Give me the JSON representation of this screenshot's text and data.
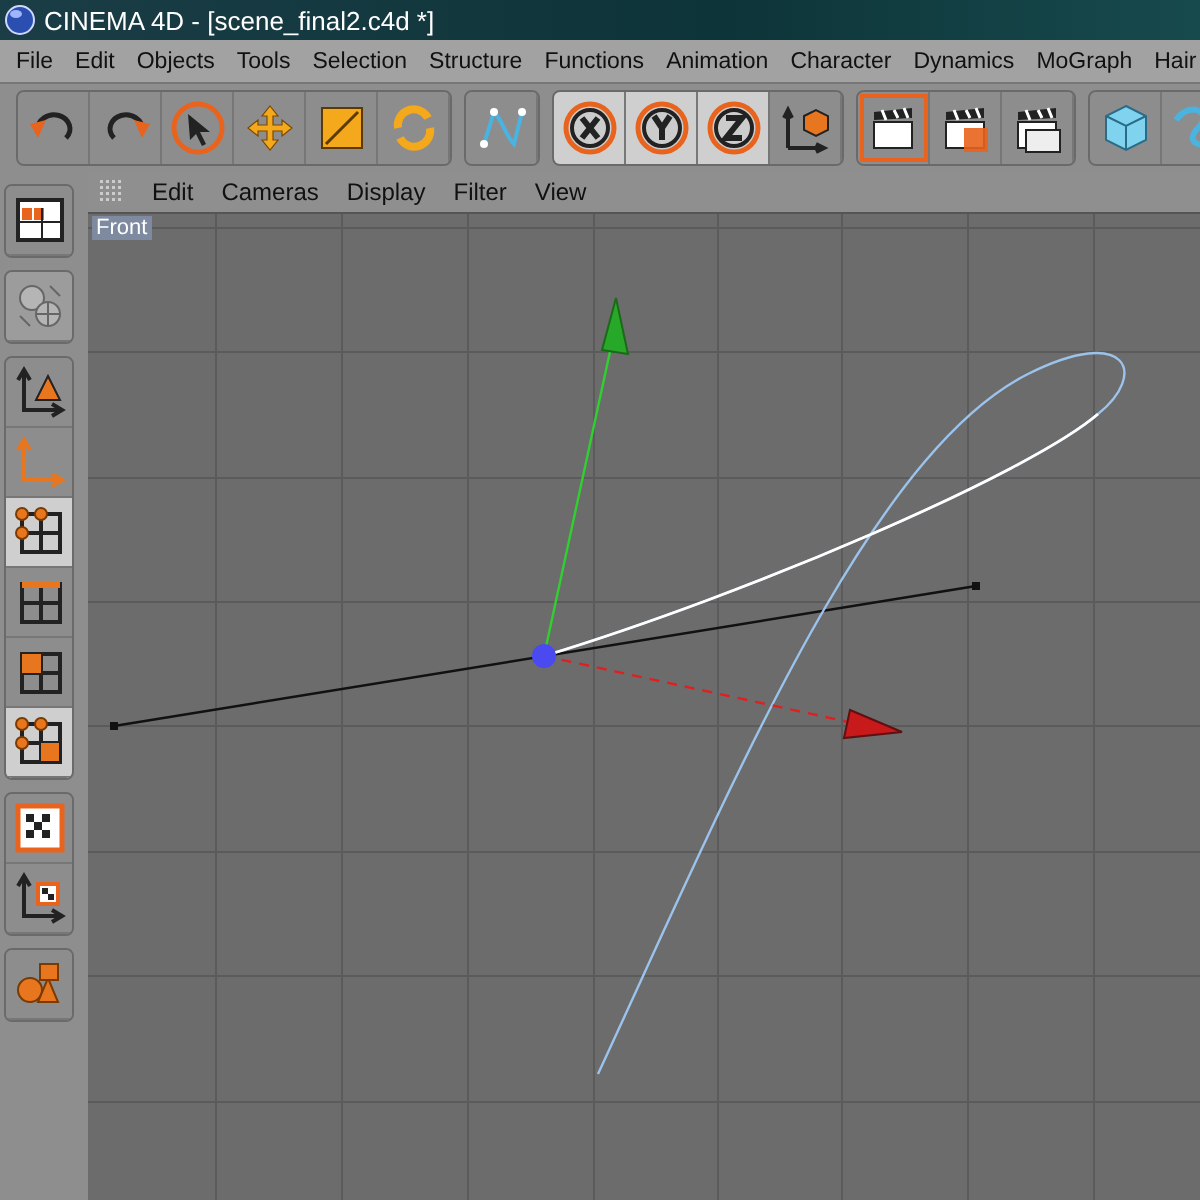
{
  "window": {
    "title": "CINEMA 4D - [scene_final2.c4d *]"
  },
  "menu_bar": [
    "File",
    "Edit",
    "Objects",
    "Tools",
    "Selection",
    "Structure",
    "Functions",
    "Animation",
    "Character",
    "Dynamics",
    "MoGraph",
    "Hair"
  ],
  "toolbar": [
    [
      {
        "kind": "undo",
        "active": false
      },
      {
        "kind": "redo",
        "active": false
      },
      {
        "kind": "select",
        "active": false
      },
      {
        "kind": "move",
        "active": false
      },
      {
        "kind": "scale",
        "active": false
      },
      {
        "kind": "rotate",
        "active": false
      }
    ],
    [
      {
        "kind": "snap",
        "active": false
      }
    ],
    [
      {
        "kind": "x",
        "active": true
      },
      {
        "kind": "y",
        "active": true
      },
      {
        "kind": "z",
        "active": true
      },
      {
        "kind": "coords",
        "active": false
      }
    ],
    [
      {
        "kind": "renderview",
        "active": true
      },
      {
        "kind": "render",
        "active": false
      },
      {
        "kind": "rendersettings",
        "active": false
      }
    ],
    [
      {
        "kind": "cube",
        "active": false
      },
      {
        "kind": "spline",
        "active": false
      }
    ]
  ],
  "left_toolbar": [
    [
      {
        "kind": "layout",
        "selected": false,
        "disabled": false
      }
    ],
    [
      {
        "kind": "generic",
        "selected": false,
        "disabled": true
      }
    ],
    [
      {
        "kind": "model",
        "selected": false,
        "disabled": false
      },
      {
        "kind": "object",
        "selected": false,
        "disabled": false
      },
      {
        "kind": "points",
        "selected": true,
        "disabled": false
      },
      {
        "kind": "edges",
        "selected": false,
        "disabled": false
      },
      {
        "kind": "polygons",
        "selected": false,
        "disabled": false
      },
      {
        "kind": "uvpoints",
        "selected": true,
        "disabled": false
      }
    ],
    [
      {
        "kind": "texture",
        "selected": false,
        "disabled": false
      },
      {
        "kind": "textureaxis",
        "selected": false,
        "disabled": false
      }
    ],
    [
      {
        "kind": "primitives",
        "selected": false,
        "disabled": false
      }
    ]
  ],
  "viewport": {
    "menu": [
      "Edit",
      "Cameras",
      "Display",
      "Filter",
      "View"
    ],
    "view_label": "Front"
  }
}
